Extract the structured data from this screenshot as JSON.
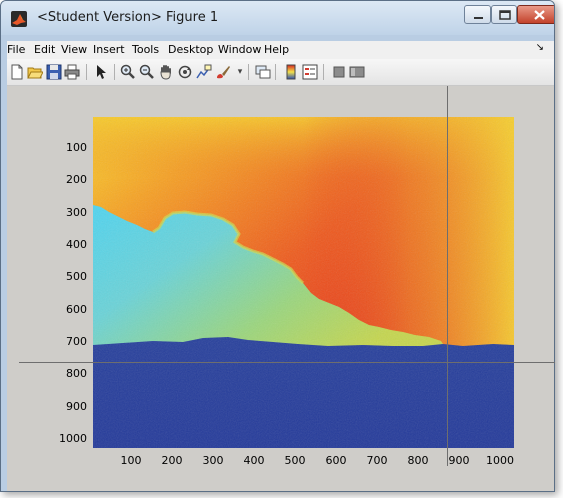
{
  "window": {
    "title": "<Student Version> Figure 1",
    "buttons": {
      "minimize": "minimize",
      "maximize": "maximize",
      "close": "close"
    }
  },
  "menubar": {
    "items": [
      "File",
      "Edit",
      "View",
      "Insert",
      "Tools",
      "Desktop",
      "Window",
      "Help"
    ]
  },
  "toolbar": {
    "icons": [
      "new-figure-icon",
      "open-file-icon",
      "save-icon",
      "print-icon",
      "arrow-select-icon",
      "zoom-in-icon",
      "zoom-out-icon",
      "pan-hand-icon",
      "rotate-3d-icon",
      "data-cursor-icon",
      "brush-icon",
      "dropdown-arrow-icon",
      "link-plot-icon",
      "colorbar-icon",
      "legend-icon",
      "hide-plot-tools-icon",
      "show-plot-tools-icon"
    ]
  },
  "chart_data": {
    "type": "heatmap",
    "title": "",
    "xlabel": "",
    "ylabel": "",
    "xlim": [
      1,
      1024
    ],
    "ylim": [
      1,
      1024
    ],
    "y_reversed": true,
    "x_ticks": [
      100,
      200,
      300,
      400,
      500,
      600,
      700,
      800,
      900,
      1000
    ],
    "y_ticks": [
      100,
      200,
      300,
      400,
      500,
      600,
      700,
      800,
      900,
      1000
    ],
    "colormap": "jet",
    "crosshair": {
      "x": 870,
      "y": 750
    },
    "colors": {
      "high": "#e8241a",
      "mid": "#f5b62a",
      "cyan": "#57d0e8",
      "low": "#243c9a"
    }
  }
}
